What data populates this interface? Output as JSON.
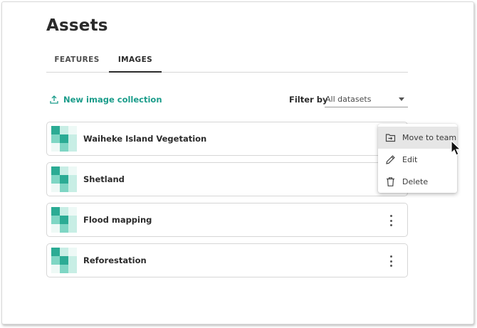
{
  "page": {
    "title": "Assets"
  },
  "tabs": [
    {
      "label": "FEATURES",
      "active": false
    },
    {
      "label": "IMAGES",
      "active": true
    }
  ],
  "toolbar": {
    "new_collection_label": "New image collection",
    "new_collection_icon": "upload-icon",
    "filter_label": "Filter by",
    "filter_value": "All datasets"
  },
  "collections": [
    {
      "name": "Waiheke Island Vegetation"
    },
    {
      "name": "Shetland"
    },
    {
      "name": "Flood mapping"
    },
    {
      "name": "Reforestation"
    }
  ],
  "context_menu": {
    "items": [
      {
        "label": "Move to team",
        "icon": "move-to-folder-icon",
        "hovered": true
      },
      {
        "label": "Edit",
        "icon": "pencil-icon",
        "hovered": false
      },
      {
        "label": "Delete",
        "icon": "trash-icon",
        "hovered": false
      }
    ]
  },
  "colors": {
    "accent": "#1a9c8a",
    "thumb_dark": "#2bab94",
    "thumb_mid": "#7fd6c4",
    "thumb_light": "#c8eee5"
  }
}
